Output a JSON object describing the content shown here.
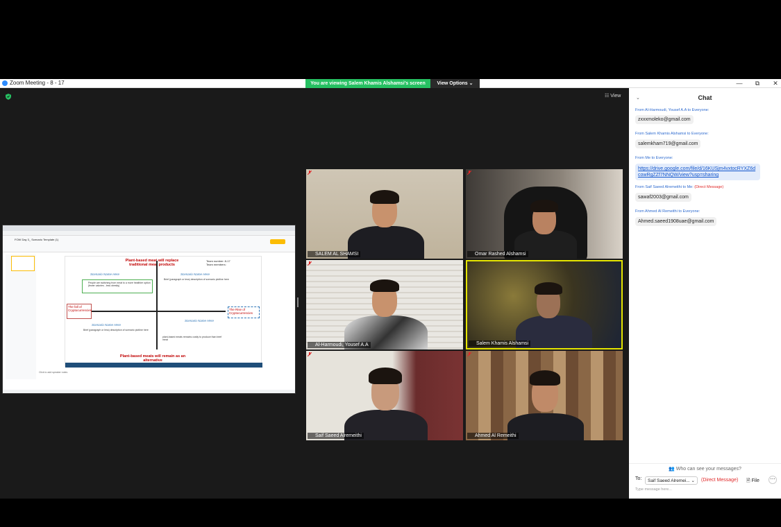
{
  "window": {
    "title": "Zoom Meeting - 8 - 17",
    "banner": "You are viewing Salem Khamis Alshamsi's screen",
    "view_options": "View Options ⌄",
    "minimize": "—",
    "restore": "⧉",
    "close": "✕"
  },
  "meeting": {
    "view_label": "☷ View"
  },
  "shared_screen": {
    "doc_title": "FOW Day 3_ Scenario Template (1)",
    "slide_top_title": "Plant-based meat will replace traditional meat products",
    "slide_bottom_title": "Plant-based meats will remain as an alternative",
    "left_box": "The fall of Cryptocurrencies",
    "right_box": "The Rise of Cryptocurrencies",
    "scenario_name": "Scenario Name Here",
    "brief_text": "Brief (paragraph or less) description of scenario plotline here",
    "team_number": "Team number: 8-17",
    "team_members": "Team members:",
    "green_box_text": "People are switching from meat to a more healthier option (fewer calories - less obesity)",
    "bottom_right_text": "plant-based meats remains costly to produce than beef meat",
    "notes": "Click to add speaker notes"
  },
  "participants": [
    {
      "name": "SALEM AL SHAMSI",
      "mic_muted": true
    },
    {
      "name": "Omar Rashed Alshamsi",
      "mic_muted": true
    },
    {
      "name": "Al-Harmoudi, Yousef A.A",
      "mic_muted": true
    },
    {
      "name": "Salem Khamis Alshamsi",
      "mic_muted": false,
      "active_speaker": true
    },
    {
      "name": "Saif Saeed Alremeithi",
      "mic_muted": true
    },
    {
      "name": "Ahmed Al Remeithi",
      "mic_muted": true
    }
  ],
  "chat": {
    "title": "Chat",
    "messages": [
      {
        "from": "From Al-Harmoudi, Yousef A.A to Everyone:",
        "text": "zxxxmoleko@gmail.com"
      },
      {
        "from": "From Salem Khamis Alshamsi to Everyone:",
        "text": "salemkham719@gmail.com"
      },
      {
        "from": "From Me to Everyone:",
        "text": "https://drive.google.com/file/d/16KUSjm4vxtocRYXZ6dcowRgZZf7NNQW/view?usp=sharing"
      },
      {
        "from": "From Saif Saeed Alremeithi to Me:",
        "dm": "(Direct Message)",
        "text": "sawaf2003@gmail.com"
      },
      {
        "from": "From Ahmed Al Remeithi to Everyone:",
        "text": "Ahmed.saeed1908uae@gmail.com"
      }
    ],
    "who_can_see": "Who can see your messages?",
    "to_label": "To:",
    "recipient": "Saif Saeed Alremei...",
    "recipient_caret": "⌄",
    "direct_message": "(Direct Message)",
    "file_label": "File",
    "more_label": "⋯",
    "placeholder": "Type message here..."
  },
  "colors": {
    "banner_green": "#26c062",
    "active_border": "#e6e600",
    "chat_link": "#1155cc",
    "dm_red": "#e02828"
  }
}
